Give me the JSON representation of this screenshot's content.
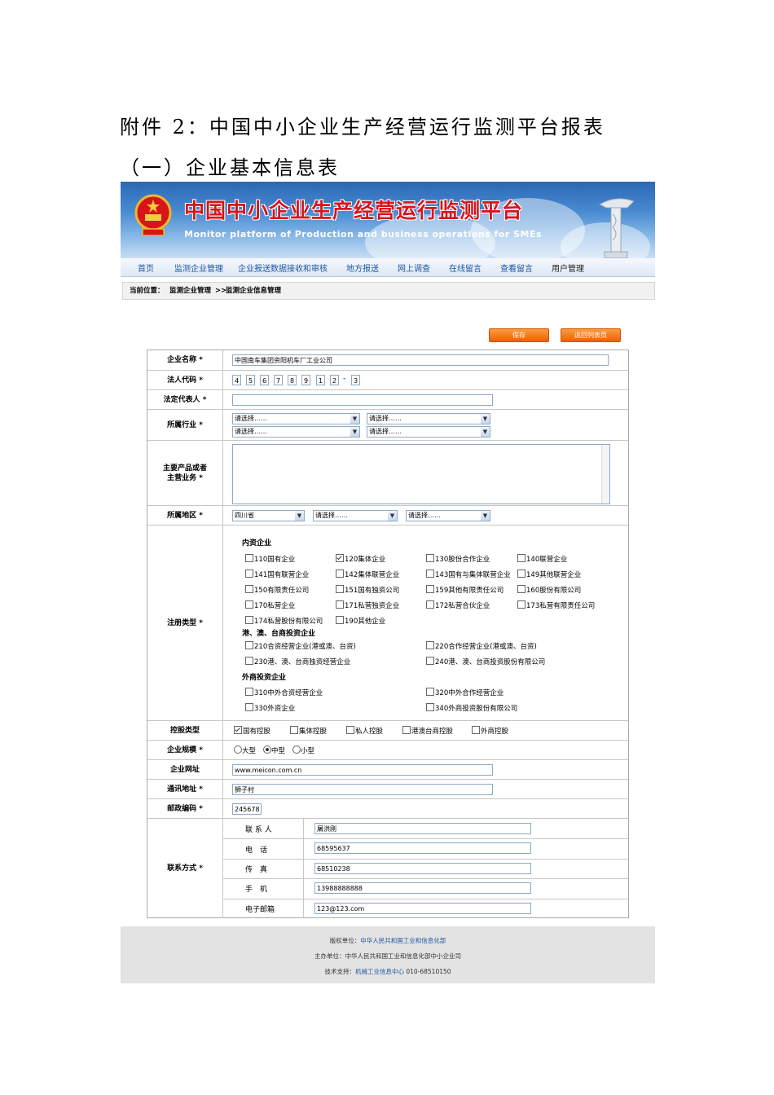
{
  "document": {
    "title": "附件 2：中国中小企业生产经营运行监测平台报表",
    "subtitle": "（一）企业基本信息表"
  },
  "banner": {
    "title_cn": "中国中小企业生产经营运行监测平台",
    "title_en": "Monitor platform of Production and business operations for SMEs"
  },
  "nav": {
    "items": [
      "首页",
      "监测企业管理",
      "企业报送数据接收和审核",
      "地方报送",
      "网上调查",
      "在线留言",
      "查看留言",
      "用户管理"
    ]
  },
  "breadcrumb": {
    "prefix": "当前位置：",
    "level1": "监测企业管理",
    "separator": ">>",
    "level2": "监测企业信息管理"
  },
  "actions": {
    "save": "保存",
    "back": "返回列表页"
  },
  "form": {
    "name": {
      "label": "企业名称 *",
      "value": "中国南车集团资阳机车厂工业公司"
    },
    "code": {
      "label": "法人代码 *",
      "digits": [
        "4",
        "5",
        "6",
        "7",
        "8",
        "9",
        "1",
        "2"
      ],
      "dash": "-",
      "check": "3"
    },
    "legal_rep": {
      "label": "法定代表人 *",
      "value": ""
    },
    "industry": {
      "label": "所属行业 *",
      "selects": [
        "请选择……",
        "请选择……",
        "请选择……",
        "请选择……"
      ]
    },
    "products": {
      "label_line1": "主要产品或者",
      "label_line2": "主营业务 *",
      "value": ""
    },
    "region": {
      "label": "所属地区 *",
      "province": "四川省",
      "city": "请选择……",
      "county": "请选择……"
    },
    "reg_type": {
      "label": "注册类型 *",
      "domestic": {
        "heading": "内资企业",
        "options": [
          {
            "text": "110国有企业",
            "checked": false
          },
          {
            "text": "120集体企业",
            "checked": true
          },
          {
            "text": "130股份合作企业",
            "checked": false
          },
          {
            "text": "140联营企业",
            "checked": false
          },
          {
            "text": "141国有联营企业",
            "checked": false
          },
          {
            "text": "142集体联营企业",
            "checked": false
          },
          {
            "text": "143国有与集体联营企业",
            "checked": false
          },
          {
            "text": "149其他联营企业",
            "checked": false
          },
          {
            "text": "150有限责任公司",
            "checked": false
          },
          {
            "text": "151国有独资公司",
            "checked": false
          },
          {
            "text": "159其他有限责任公司",
            "checked": false
          },
          {
            "text": "160股份有限公司",
            "checked": false
          },
          {
            "text": "170私营企业",
            "checked": false
          },
          {
            "text": "171私营独资企业",
            "checked": false
          },
          {
            "text": "172私营合伙企业",
            "checked": false
          },
          {
            "text": "173私营有限责任公司",
            "checked": false
          },
          {
            "text": "174私营股份有限公司",
            "checked": false
          },
          {
            "text": "190其他企业",
            "checked": false
          }
        ]
      },
      "hmt": {
        "heading": "港、澳、台商投资企业",
        "options": [
          {
            "text": "210合资经营企业(港或澳、台资)",
            "checked": false
          },
          {
            "text": "220合作经营企业(港或澳、台资)",
            "checked": false
          },
          {
            "text": "230港、澳、台商独资经营企业",
            "checked": false
          },
          {
            "text": "240港、澳、台商投资股份有限公司",
            "checked": false
          }
        ]
      },
      "foreign": {
        "heading": "外商投资企业",
        "options": [
          {
            "text": "310中外合资经营企业",
            "checked": false
          },
          {
            "text": "320中外合作经营企业",
            "checked": false
          },
          {
            "text": "330外资企业",
            "checked": false
          },
          {
            "text": "340外商投资股份有限公司",
            "checked": false
          }
        ]
      }
    },
    "holding": {
      "label": "控股类型",
      "options": [
        {
          "text": "国有控股",
          "checked": true
        },
        {
          "text": "集体控股",
          "checked": false
        },
        {
          "text": "私人控股",
          "checked": false
        },
        {
          "text": "港澳台商控股",
          "checked": false
        },
        {
          "text": "外商控股",
          "checked": false
        }
      ]
    },
    "scale": {
      "label": "企业规模 *",
      "options": [
        {
          "text": "大型",
          "checked": false
        },
        {
          "text": "中型",
          "checked": true
        },
        {
          "text": "小型",
          "checked": false
        }
      ]
    },
    "website": {
      "label": "企业网址",
      "value": "www.meicon.com.cn"
    },
    "address": {
      "label": "通讯地址 *",
      "value": "狮子村"
    },
    "postcode": {
      "label": "邮政编码 *",
      "value": "245678"
    },
    "contact": {
      "label": "联系方式 *",
      "rows": [
        {
          "label": "联 系 人",
          "value": "屠洪刚"
        },
        {
          "label": "电　话",
          "value": "68595637"
        },
        {
          "label": "传　真",
          "value": "68510238"
        },
        {
          "label": "手　机",
          "value": "13988888888"
        },
        {
          "label": "电子邮箱",
          "value": "123@123.com"
        }
      ]
    }
  },
  "footer": {
    "copyright_label": "版权单位：",
    "copyright_value": "中华人民共和国工业和信息化部",
    "host": "主办单位：中华人民共和国工业和信息化部中小企业司",
    "support_label": "技术支持：",
    "support_value": "机械工业信息中心",
    "support_phone": "010-68510150"
  }
}
